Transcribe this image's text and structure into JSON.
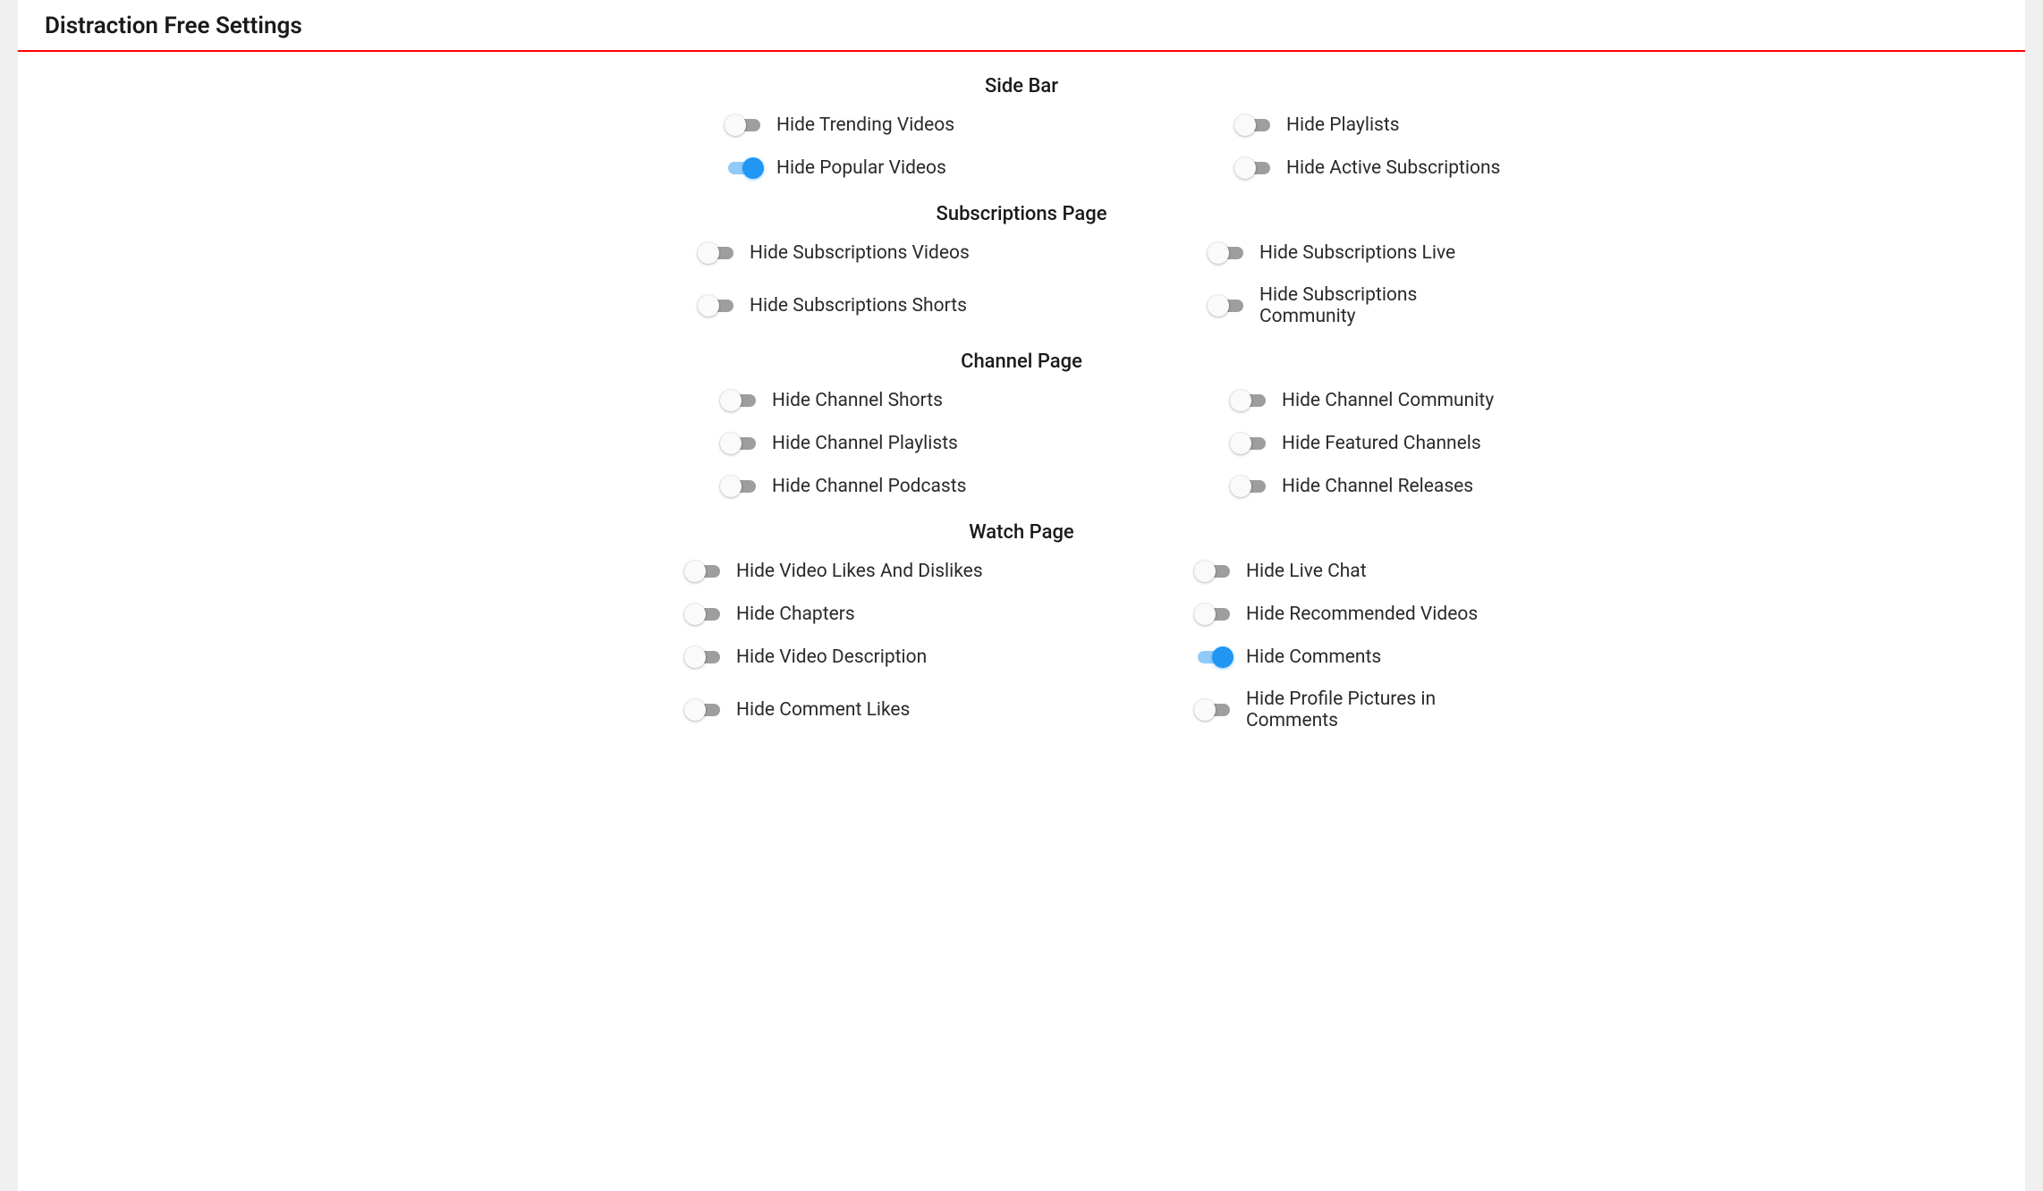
{
  "title": "Distraction Free Settings",
  "sections": {
    "sidebar": {
      "heading": "Side Bar",
      "items": [
        {
          "label": "Hide Trending Videos",
          "checked": false
        },
        {
          "label": "Hide Playlists",
          "checked": false
        },
        {
          "label": "Hide Popular Videos",
          "checked": true
        },
        {
          "label": "Hide Active Subscriptions",
          "checked": false
        }
      ]
    },
    "subscriptions": {
      "heading": "Subscriptions Page",
      "items": [
        {
          "label": "Hide Subscriptions Videos",
          "checked": false
        },
        {
          "label": "Hide Subscriptions Live",
          "checked": false
        },
        {
          "label": "Hide Subscriptions Shorts",
          "checked": false
        },
        {
          "label": "Hide Subscriptions Community",
          "checked": false
        }
      ]
    },
    "channel": {
      "heading": "Channel Page",
      "items": [
        {
          "label": "Hide Channel Shorts",
          "checked": false
        },
        {
          "label": "Hide Channel Community",
          "checked": false
        },
        {
          "label": "Hide Channel Playlists",
          "checked": false
        },
        {
          "label": "Hide Featured Channels",
          "checked": false
        },
        {
          "label": "Hide Channel Podcasts",
          "checked": false
        },
        {
          "label": "Hide Channel Releases",
          "checked": false
        }
      ]
    },
    "watch": {
      "heading": "Watch Page",
      "items": [
        {
          "label": "Hide Video Likes And Dislikes",
          "checked": false
        },
        {
          "label": "Hide Live Chat",
          "checked": false
        },
        {
          "label": "Hide Chapters",
          "checked": false
        },
        {
          "label": "Hide Recommended Videos",
          "checked": false
        },
        {
          "label": "Hide Video Description",
          "checked": false
        },
        {
          "label": "Hide Comments",
          "checked": true
        },
        {
          "label": "Hide Comment Likes",
          "checked": false
        },
        {
          "label": "Hide Profile Pictures in Comments",
          "checked": false
        }
      ]
    }
  }
}
